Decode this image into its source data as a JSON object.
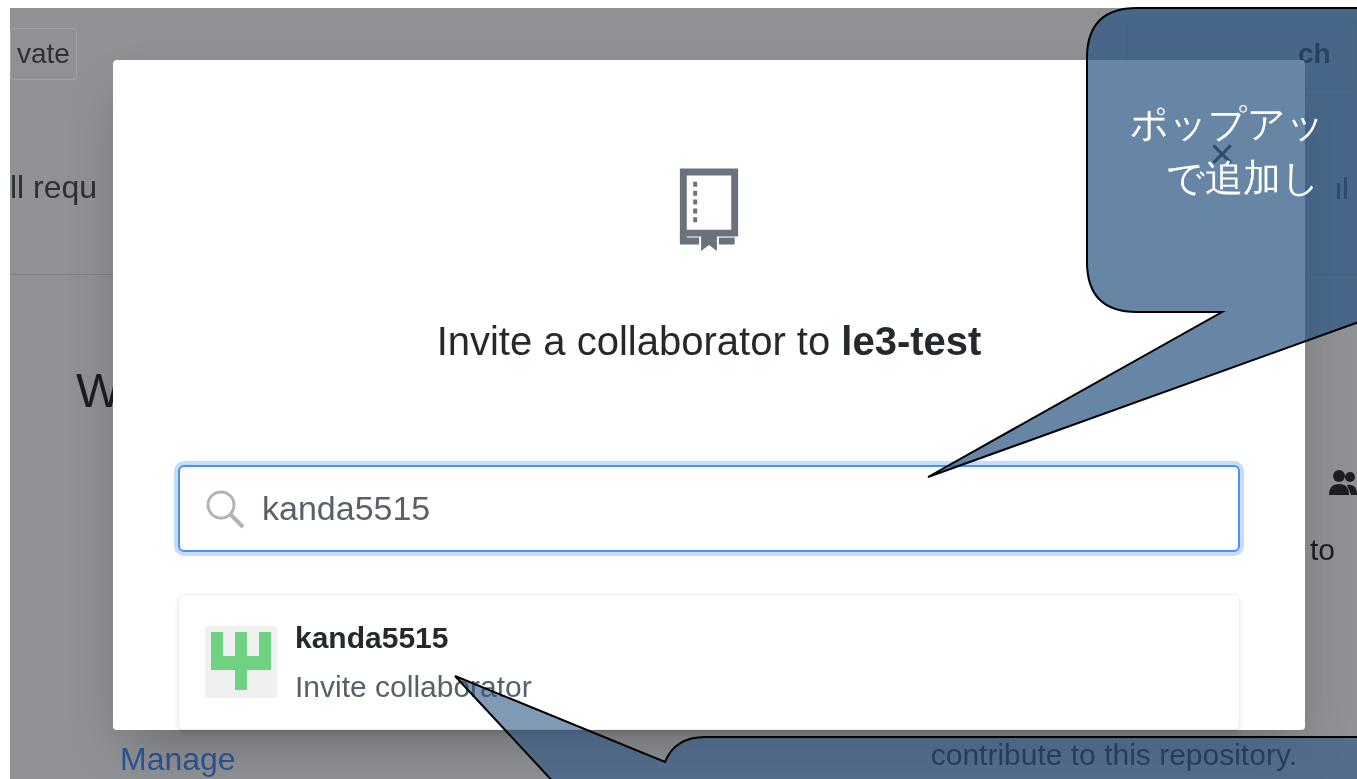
{
  "background": {
    "visibility_badge": "vate",
    "search_button": "ch",
    "tab": "ll requ",
    "heading": "W",
    "side_text": "to",
    "side_note": "contribute to this repository.",
    "manage_link": "Manage"
  },
  "dialog": {
    "close_label": "×",
    "title": "Invite a collaborator to **le3-test**",
    "search": {
      "value": "kanda5515"
    },
    "result": {
      "username": "kanda5515",
      "action": "Invite collaborator"
    }
  },
  "callouts": [
    {
      "kind": "top",
      "lines": [
        "ポップアッ",
        "で追加し"
      ]
    },
    {
      "kind": "bottom"
    }
  ]
}
